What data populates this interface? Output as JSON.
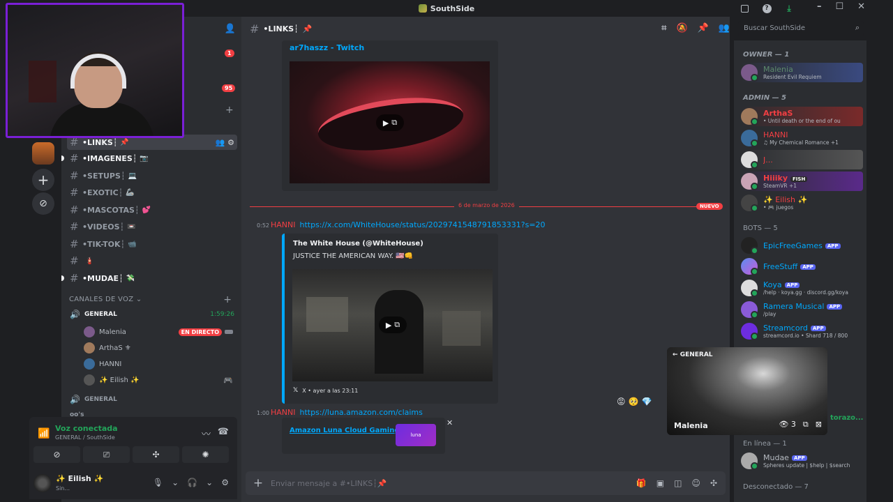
{
  "window": {
    "title": "SouthSide"
  },
  "channels": {
    "badges": [
      "1",
      "95"
    ],
    "items": [
      {
        "label": "•LINKS┆",
        "emoji": "📌",
        "active": true
      },
      {
        "label": "•IMAGENES┆",
        "emoji": "📷"
      },
      {
        "label": "•SETUPS┆",
        "emoji": "💻"
      },
      {
        "label": "•EXOTIC┆",
        "emoji": "🦾"
      },
      {
        "label": "•MASCOTAS┆",
        "emoji": "💕"
      },
      {
        "label": "•VIDEOS┆",
        "emoji": "📼"
      },
      {
        "label": "•TIK-TOK┆",
        "emoji": "📹"
      },
      {
        "label": "",
        "emoji": "🧯"
      },
      {
        "label": "•MUDAE┆",
        "emoji": "💸"
      }
    ],
    "voice_category": "CANALES DE VOZ",
    "voice_channel": {
      "name": "GENERAL",
      "timer": "1:59:26"
    },
    "voice_users": [
      {
        "name": "Malenia",
        "live": "EN DIRECTO"
      },
      {
        "name": "ArthaS ⚜"
      },
      {
        "name": "HANNI"
      },
      {
        "name": "✨ Eilish ✨"
      }
    ],
    "voice_channel_2": "GENERAL",
    "cut_channel": "oo's"
  },
  "voice_panel": {
    "title": "Voz conectada",
    "subtitle": "GENERAL / SouthSide"
  },
  "user_panel": {
    "name": "✨ Eilish ✨",
    "status": "Sin..."
  },
  "chat": {
    "channel": "•LINKS┆",
    "embed1_title": "ar7haszz - Twitch",
    "divider_date": "6 de marzo de 2026",
    "divider_new": "NUEVO",
    "msg1": {
      "time": "0:52",
      "author": "HANNI",
      "link": "https://x.com/WhiteHouse/status/2029741548791853331?s=20"
    },
    "x_embed": {
      "author": "The White House (@WhiteHouse)",
      "text": "JUSTICE THE AMERICAN WAY. 🇺🇸👊",
      "footer": "X • ayer a las 23:11"
    },
    "msg2": {
      "time": "1:00",
      "author": "HANNI",
      "link": "https://luna.amazon.com/claims"
    },
    "luna_embed": {
      "title": "Amazon Luna Cloud Gaming",
      "thumb": "luna"
    },
    "composer_placeholder": "Enviar mensaje a #•LINKS┆📌"
  },
  "search": {
    "placeholder": "Buscar SouthSide"
  },
  "members": {
    "owner_label": "OWNER — 1",
    "owner": [
      {
        "name": "Malenia",
        "status": "Resident Evil Requiem",
        "color": "#23a55a"
      }
    ],
    "admin_label": "ADMIN — 5",
    "admins": [
      {
        "name": "ArthaS",
        "status": "• Until death or the end of ou",
        "color": "#f23f43"
      },
      {
        "name": "HANNI",
        "status": "♫ My Chemical Romance +1",
        "color": "#f23f43"
      },
      {
        "name": "J...",
        "status": "",
        "color": "#f23f43"
      },
      {
        "name": "Hiiiky",
        "tag": "FISH",
        "status": "SteamVR +1",
        "color": "#f23f43"
      },
      {
        "name": "✨ Eilish ✨",
        "status": "• 🎮 juegos",
        "color": "#f23f43"
      }
    ],
    "bots_label": "BOTS — 5",
    "bots": [
      {
        "name": "EpicFreeGames",
        "status": "",
        "tag": "APP"
      },
      {
        "name": "FreeStuff",
        "status": "",
        "tag": "APP"
      },
      {
        "name": "Koya",
        "status": "/help · koya.gg · discord.gg/koya",
        "tag": "APP"
      },
      {
        "name": "Ramera Musical",
        "status": "/play",
        "tag": "APP"
      },
      {
        "name": "Streamcord",
        "status": "streamcord.io • Shard 718 / 800",
        "tag": "APP"
      }
    ],
    "online_label": "En línea — 1",
    "online": [
      {
        "name": "Mudae",
        "status": "Spheres update | $help | $search",
        "tag": "APP"
      }
    ],
    "offline_label": "Desconectado — 7"
  },
  "popout": {
    "channel": "GENERAL",
    "streamer": "Malenia",
    "viewers": "3"
  },
  "cut_text": "torazo..."
}
